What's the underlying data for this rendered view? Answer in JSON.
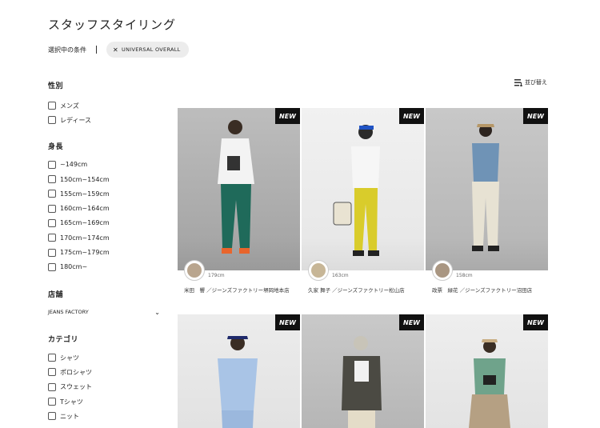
{
  "page_title": "スタッフスタイリング",
  "conditions": {
    "label": "選択中の条件",
    "chip": "UNIVERSAL OVERALL"
  },
  "sort_label": "並び替え",
  "filters": {
    "gender": {
      "title": "性別",
      "options": [
        "メンズ",
        "レディース"
      ]
    },
    "height": {
      "title": "身長",
      "options": [
        "~149cm",
        "150cm~154cm",
        "155cm~159cm",
        "160cm~164cm",
        "165cm~169cm",
        "170cm~174cm",
        "175cm~179cm",
        "180cm~"
      ]
    },
    "store": {
      "title": "店舗",
      "selected": "JEANS FACTORY"
    },
    "category": {
      "title": "カテゴリ",
      "options": [
        "シャツ",
        "ポロシャツ",
        "スウェット",
        "Tシャツ",
        "ニット"
      ]
    }
  },
  "badge": "NEW",
  "cards": [
    {
      "height": "179cm",
      "name": "米田　響 ／ジーンズファクトリー堺岡地本店"
    },
    {
      "height": "163cm",
      "name": "久家 舞子 ／ジーンズファクトリー松山店"
    },
    {
      "height": "158cm",
      "name": "政票　緑花 ／ジーンズファクトリー沼田店"
    },
    {
      "height": "",
      "name": ""
    },
    {
      "height": "",
      "name": ""
    },
    {
      "height": "",
      "name": ""
    }
  ],
  "colors": {
    "badge_bg": "#111111",
    "chip_bg": "#ececec"
  }
}
